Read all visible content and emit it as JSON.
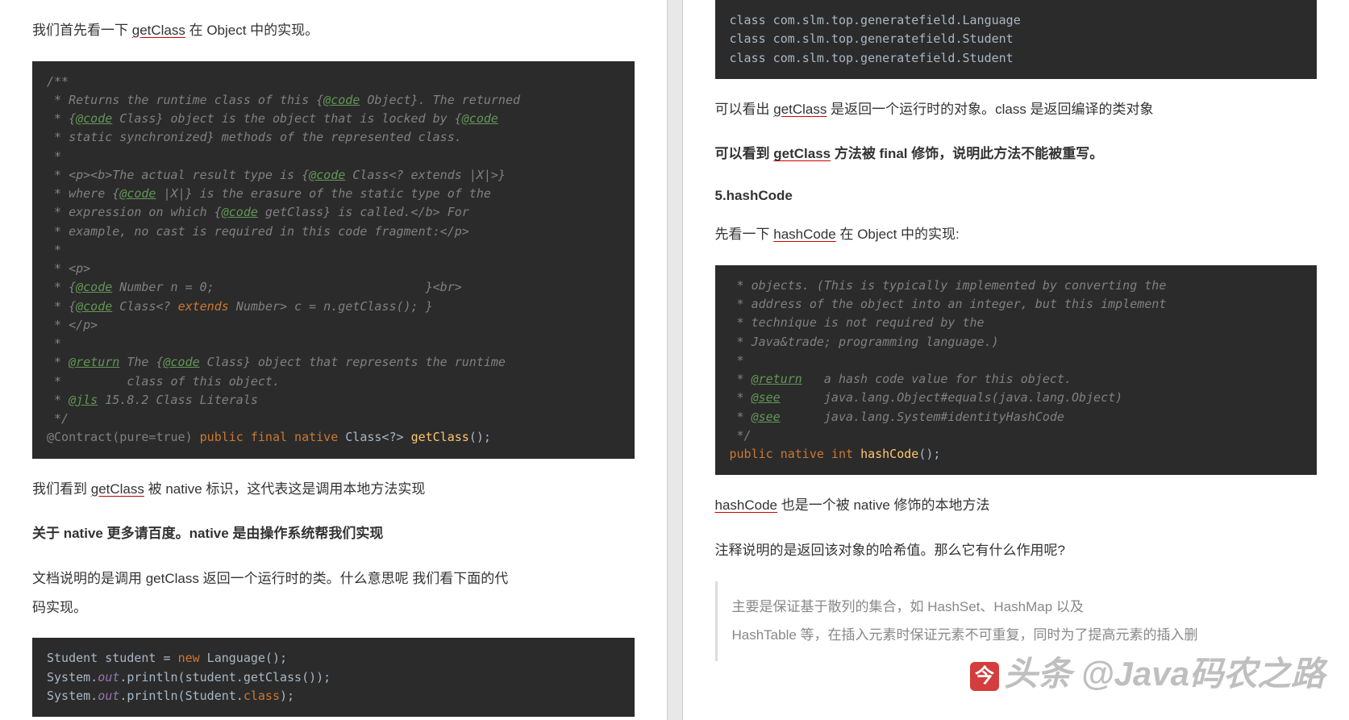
{
  "left": {
    "p1": "我们首先看一下 getClass 在 Object 中的实现。",
    "code1": "/**\n * Returns the runtime class of this {@code Object}. The returned\n * {@code Class} object is the object that is locked by {@code\n * static synchronized} methods of the represented class.\n *\n * <p><b>The actual result type is {@code Class<? extends |X|>}\n * where {@code |X|} is the erasure of the static type of the\n * expression on which {@code getClass} is called.</b> For\n * example, no cast is required in this code fragment:</p>\n *\n * <p>\n * {@code Number n = 0;                             }<br>\n * {@code Class<? extends Number> c = n.getClass(); }\n * </p>\n *\n * @return The {@code Class} object that represents the runtime\n *         class of this object.\n * @jls 15.8.2 Class Literals\n */\n@Contract(pure=true) public final native Class<?> getClass();",
    "p2": "我们看到 getClass 被 native 标识，这代表这是调用本地方法实现",
    "p3": "关于 native 更多请百度。native 是由操作系统帮我们实现",
    "p4a": "文档说明的是调用 getClass 返回一个运行时的类。什么意思呢  我们看下面的代",
    "p4b": "码实现。",
    "code2_l1": "Student student = new Language();",
    "code2_l2": "System.out.println(student.getClass());",
    "code2_l3": "System.out.println(Student.class);"
  },
  "right": {
    "code3": "class com.slm.top.generatefield.Language\nclass com.slm.top.generatefield.Student\nclass com.slm.top.generatefield.Student",
    "p5": "可以看出 getClass 是返回一个运行时的对象。class 是返回编译的类对象",
    "p6": "可以看到 getClass 方法被 final 修饰，说明此方法不能被重写。",
    "h5": "5.hashCode",
    "p7": "先看一下 hashCode 在 Object 中的实现:",
    "code4": " * objects. (This is typically implemented by converting the\n * address of the object into an integer, but this implement\n * technique is not required by the\n * Java&trade; programming language.)\n *\n * @return   a hash code value for this object.\n * @see      java.lang.Object#equals(java.lang.Object)\n * @see      java.lang.System#identityHashCode\n */\npublic native int hashCode();",
    "p8": "hashCode 也是一个被 native 修饰的本地方法",
    "p9": "注释说明的是返回该对象的哈希值。那么它有什么作用呢?",
    "quote_a": "主要是保证基于散列的集合，如 HashSet、HashMap 以及",
    "quote_b": "HashTable 等，在插入元素时保证元素不可重复，同时为了提高元素的插入删"
  },
  "watermark": "头条 @Java码农之路"
}
